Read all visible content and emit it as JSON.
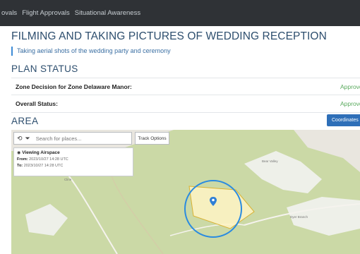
{
  "nav": {
    "items": [
      "ovals",
      "Flight Approvals",
      "Situational Awareness"
    ]
  },
  "page": {
    "title": "FILMING AND TAKING PICTURES OF WEDDING RECEPTION",
    "subtitle": "Taking aerial shots of the wedding party and ceremony"
  },
  "plan_status": {
    "heading": "PLAN STATUS",
    "rows": [
      {
        "label": "Zone Decision for Zone Delaware Manor:",
        "value": "Approved"
      },
      {
        "label": "Overall Status:",
        "value": "Approved"
      }
    ]
  },
  "area": {
    "heading": "AREA",
    "coordinates_button": "Coordinates"
  },
  "map": {
    "search_placeholder": "Search for places...",
    "track_options_label": "Track Options",
    "info": {
      "title": "Viewing Airspace",
      "from_label": "From:",
      "from_value": "2023/10/27 14:28 UTC",
      "to_label": "To:",
      "to_value": "2023/10/27 14:28 UTC"
    },
    "place_labels": [
      "Bear Valley",
      "Cline",
      "Dyer Branch"
    ],
    "colors": {
      "land": "#e9e6df",
      "park": "#c9d9a3",
      "zone_fill": "#fff4c8",
      "zone_stroke": "#d9b233",
      "circle": "#2a8be0",
      "marker": "#2f7fd6"
    }
  }
}
